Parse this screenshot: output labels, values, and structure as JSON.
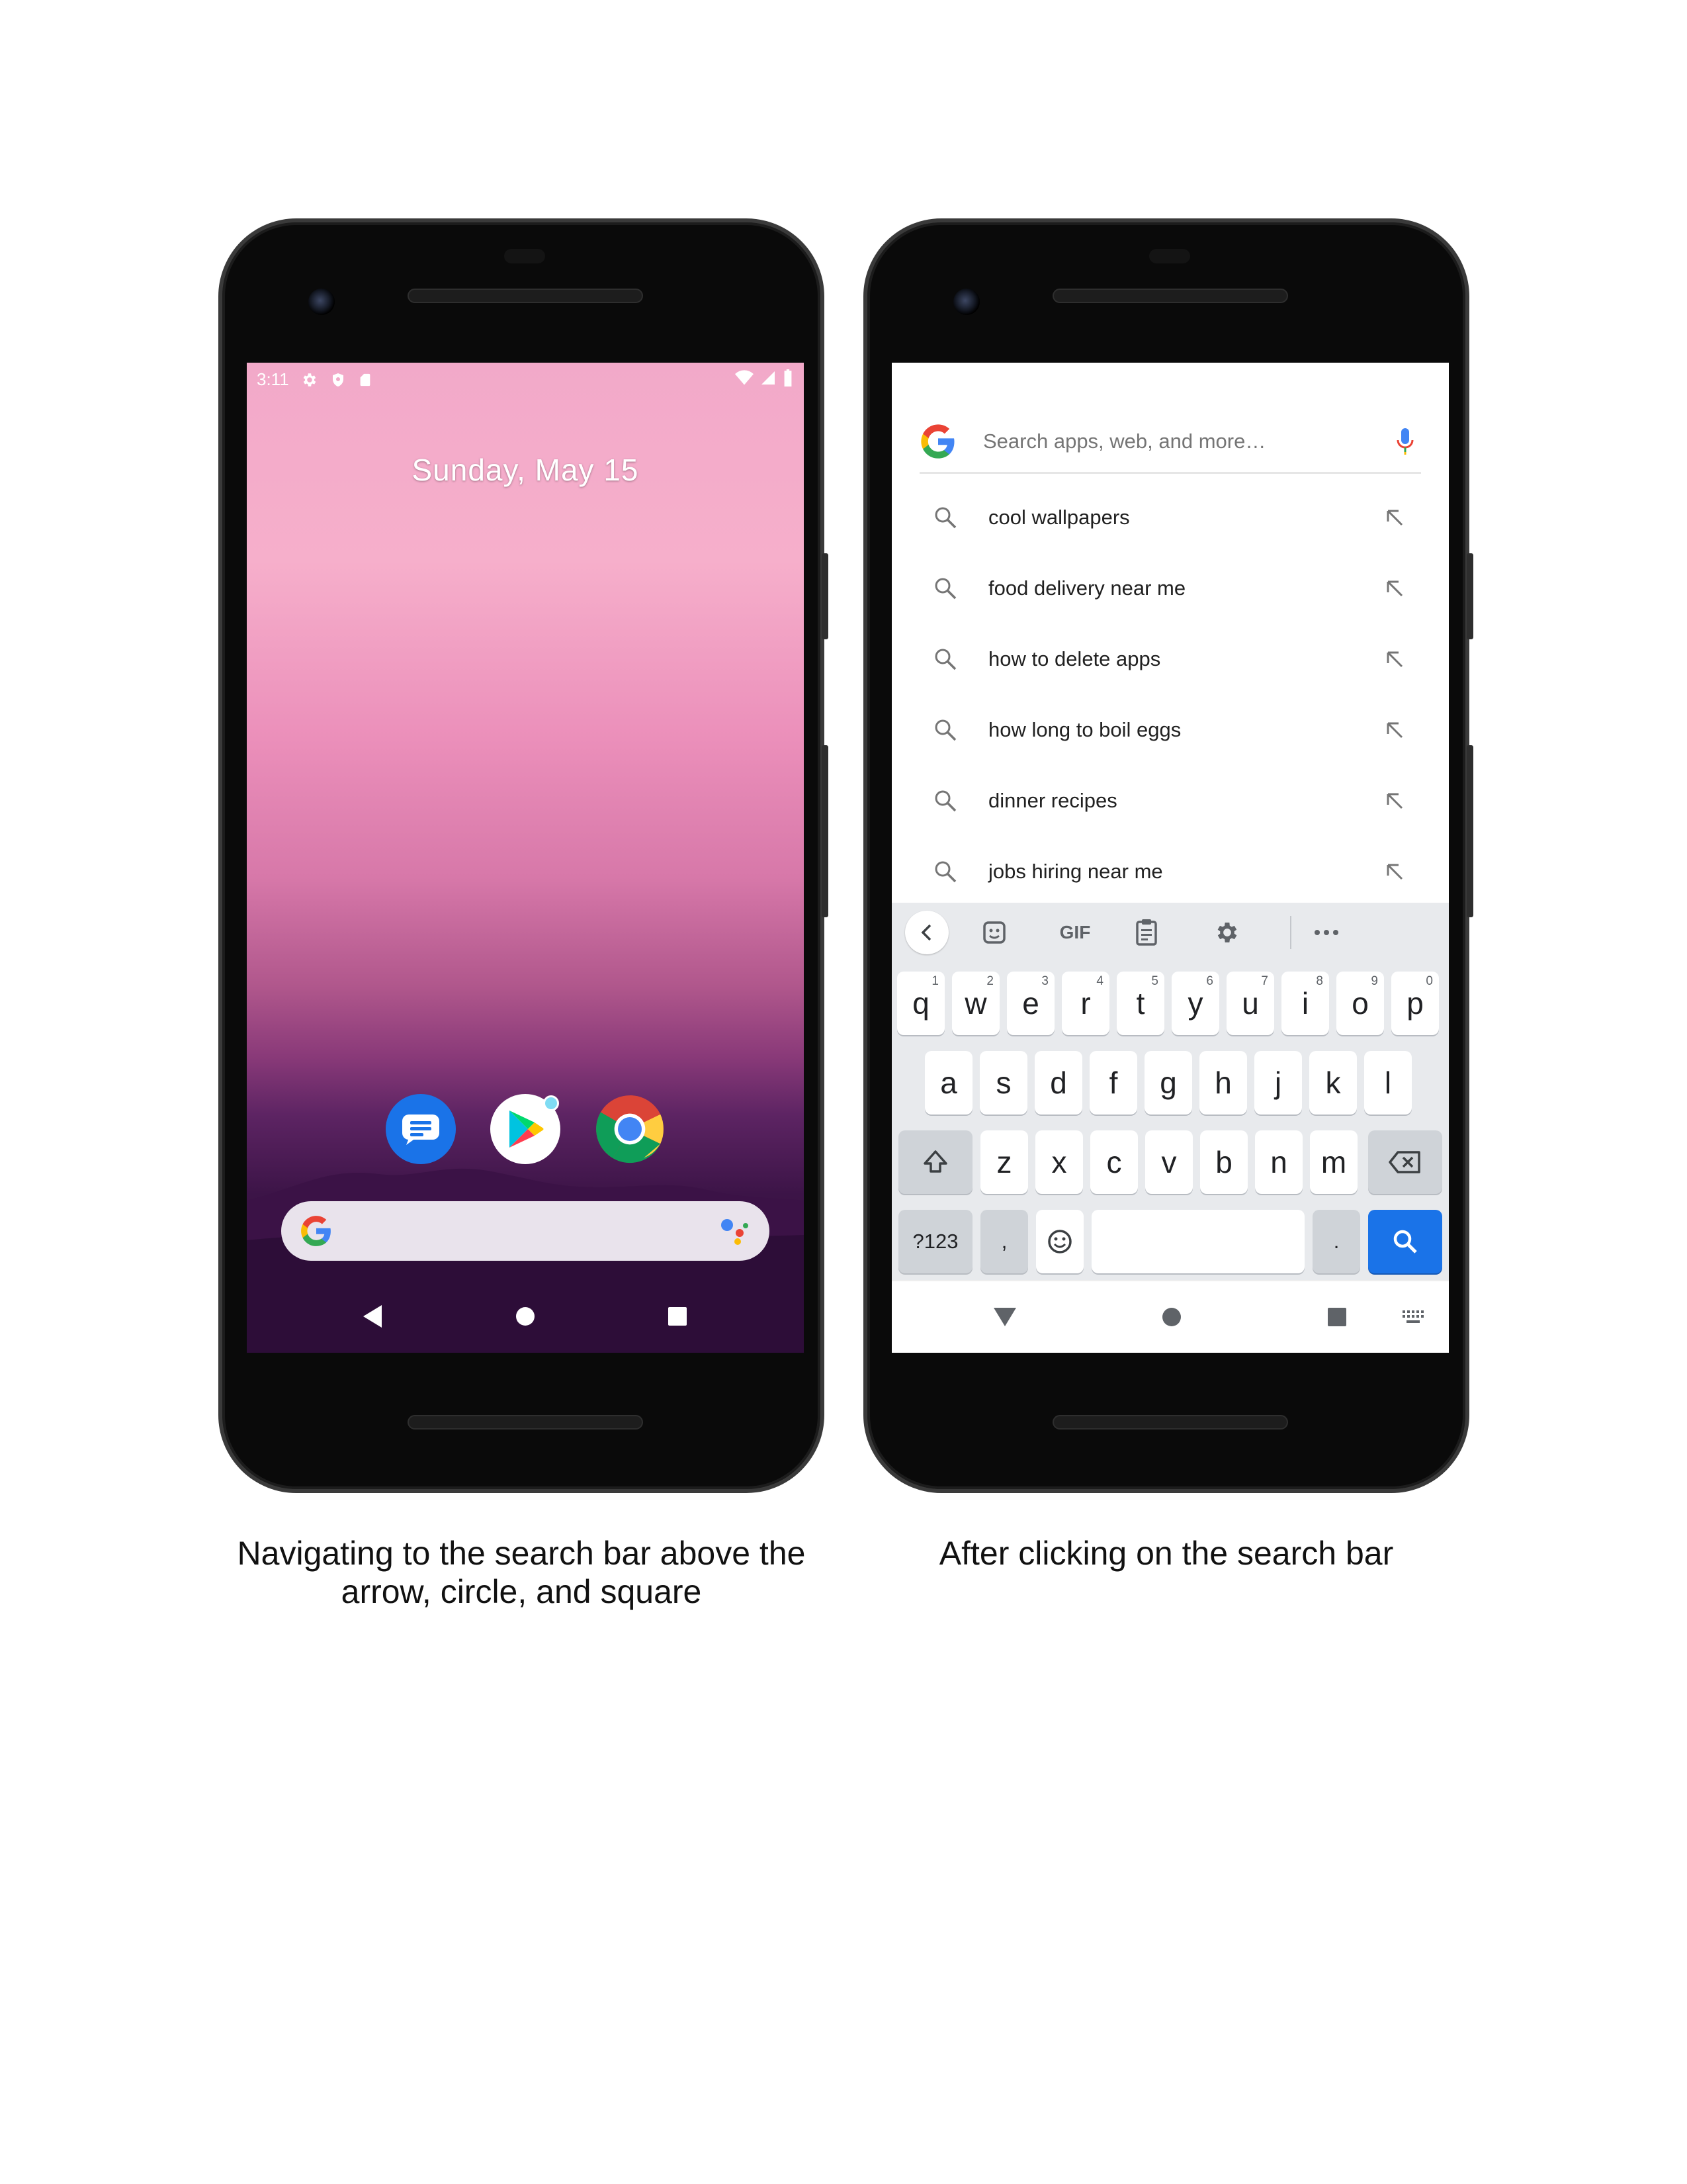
{
  "left_phone": {
    "status_bar": {
      "time": "3:11",
      "left_icons": [
        "settings-icon",
        "shield-icon",
        "sd-card-icon"
      ],
      "right_icons": [
        "wifi-icon",
        "signal-icon",
        "battery-icon"
      ]
    },
    "date_widget": "Sunday, May 15",
    "dock_apps": [
      "messages-app-icon",
      "play-store-app-icon",
      "chrome-app-icon"
    ],
    "search_widget": {
      "left_icon": "google-g-icon",
      "right_icon": "google-assistant-icon"
    },
    "nav_bar": [
      "back-triangle-icon",
      "home-circle-icon",
      "recents-square-icon"
    ],
    "colors": {
      "wallpaper_top": "#f2a9c9",
      "wallpaper_bottom": "#2a0e35",
      "search_bar": "#e9e3ec"
    }
  },
  "right_phone": {
    "search": {
      "placeholder": "Search apps, web, and more…",
      "value": ""
    },
    "suggestions": [
      {
        "text": "cool wallpapers"
      },
      {
        "text": "food delivery near me"
      },
      {
        "text": "how to delete apps"
      },
      {
        "text": "how long to boil eggs"
      },
      {
        "text": "dinner recipes"
      },
      {
        "text": "jobs hiring near me"
      }
    ],
    "keyboard": {
      "toolbar": {
        "gif_label": "GIF",
        "icons": [
          "chevron-left-icon",
          "sticker-icon",
          "gif-icon",
          "clipboard-icon",
          "gear-icon",
          "more-icon"
        ]
      },
      "row1": [
        {
          "key": "q",
          "hint": "1"
        },
        {
          "key": "w",
          "hint": "2"
        },
        {
          "key": "e",
          "hint": "3"
        },
        {
          "key": "r",
          "hint": "4"
        },
        {
          "key": "t",
          "hint": "5"
        },
        {
          "key": "y",
          "hint": "6"
        },
        {
          "key": "u",
          "hint": "7"
        },
        {
          "key": "i",
          "hint": "8"
        },
        {
          "key": "o",
          "hint": "9"
        },
        {
          "key": "p",
          "hint": "0"
        }
      ],
      "row2": [
        "a",
        "s",
        "d",
        "f",
        "g",
        "h",
        "j",
        "k",
        "l"
      ],
      "row3": [
        "z",
        "x",
        "c",
        "v",
        "b",
        "n",
        "m"
      ],
      "symbols_label": "?123",
      "comma_label": ",",
      "period_label": ".",
      "accent_color": "#1a73e8"
    },
    "nav_bar": [
      "back-down-triangle-icon",
      "home-circle-icon",
      "recents-square-icon",
      "keyboard-switch-icon"
    ]
  },
  "captions": {
    "left": "Navigating to the search bar above the arrow, circle, and square",
    "right": "After clicking on the search bar"
  }
}
